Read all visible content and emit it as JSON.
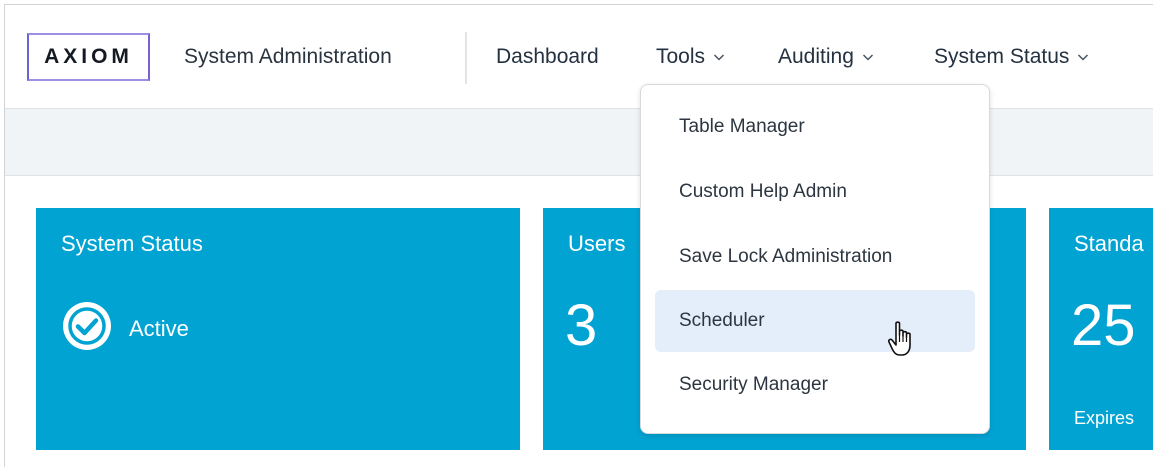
{
  "header": {
    "logo_text": "AXIOM",
    "app_title": "System Administration",
    "nav": [
      {
        "label": "Dashboard",
        "has_dropdown": false
      },
      {
        "label": "Tools",
        "has_dropdown": true,
        "open": true
      },
      {
        "label": "Auditing",
        "has_dropdown": true
      },
      {
        "label": "System Status",
        "has_dropdown": true
      }
    ]
  },
  "tools_menu": {
    "items": [
      {
        "label": "Table Manager"
      },
      {
        "label": "Custom Help Admin"
      },
      {
        "label": "Save Lock Administration"
      },
      {
        "label": "Scheduler",
        "hovered": true
      },
      {
        "label": "Security Manager"
      }
    ]
  },
  "tiles": {
    "system_status": {
      "title": "System Status",
      "status": "Active",
      "icon": "check-circle-icon"
    },
    "users": {
      "title": "Users",
      "value": "3"
    },
    "standard": {
      "title": "Standa",
      "value": "25",
      "footer": "Expires"
    }
  },
  "colors": {
    "tile_blue": "#00a3d2",
    "menu_hover": "#e3eefa",
    "subbar": "#f1f4f7"
  }
}
